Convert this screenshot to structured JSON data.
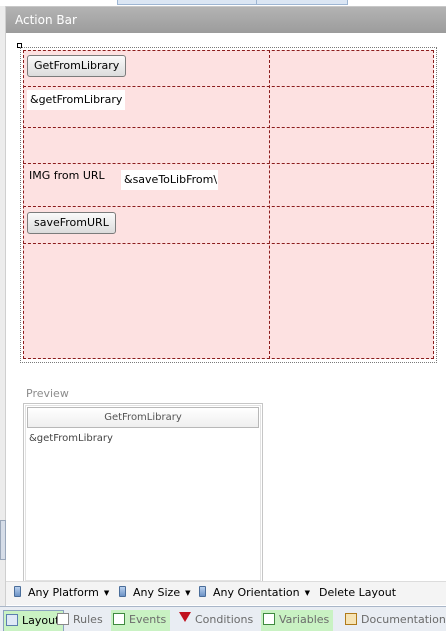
{
  "header": {
    "title": "Action Bar"
  },
  "grid": {
    "get_from_library_button": "GetFromLibrary",
    "get_from_library_field": "&getFromLibrary",
    "img_from_url_label": "IMG from URL",
    "save_to_lib_field": "&saveToLibFrom\\",
    "save_from_url_button": "saveFromURL"
  },
  "preview": {
    "label": "Preview",
    "button": "GetFromLibrary",
    "field": "&getFromLibrary"
  },
  "layout_bar": {
    "platform": "Any Platform",
    "size": "Any Size",
    "orientation": "Any Orientation",
    "delete": "Delete Layout"
  },
  "tabs": [
    {
      "label": "Layout",
      "icon": "layout-icon",
      "active": true,
      "highlight": "#c9f2c3"
    },
    {
      "label": "Rules",
      "icon": "rules-icon"
    },
    {
      "label": "Events",
      "icon": "events-icon",
      "highlight": "#c9f2c3"
    },
    {
      "label": "Conditions",
      "icon": "filter-icon"
    },
    {
      "label": "Variables",
      "icon": "variables-icon",
      "highlight": "#c9f2c3"
    },
    {
      "label": "Documentation",
      "icon": "documentation-icon"
    }
  ],
  "colors": {
    "grid_fill": "#fde1e1",
    "grid_border": "#8b1c1c",
    "header": "#a6a6a6",
    "tab_highlight": "#c9f2c3"
  }
}
